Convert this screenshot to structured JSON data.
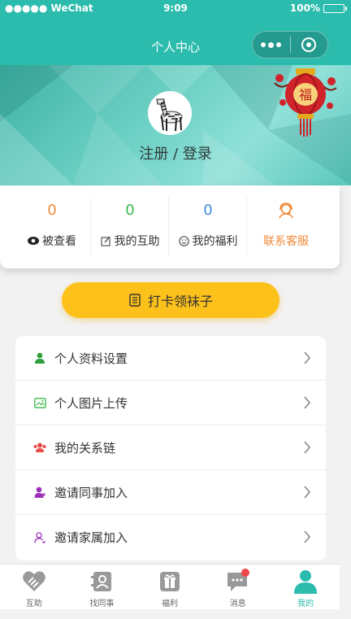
{
  "status_bar": {
    "carrier": "●●●●● WeChat",
    "time": "9:09",
    "battery": "100%"
  },
  "nav": {
    "title": "个人中心"
  },
  "profile": {
    "login_text": "注册 / 登录"
  },
  "stats": [
    {
      "value": "0",
      "label": "被查看",
      "icon": "eye-icon",
      "color": "#f08a3a"
    },
    {
      "value": "0",
      "label": "我的互助",
      "icon": "edit-icon",
      "color": "#3bb84a"
    },
    {
      "value": "0",
      "label": "我的福利",
      "icon": "smile-icon",
      "color": "#3a8fe0"
    },
    {
      "value": "",
      "label": "联系客服",
      "icon": "customer-service-icon",
      "color": "#f08a3a"
    }
  ],
  "checkin": {
    "label": "打卡领袜子",
    "icon": "list-icon"
  },
  "menu": [
    {
      "label": "个人资料设置",
      "icon": "user-icon",
      "color": "#2f9e3a"
    },
    {
      "label": "个人图片上传",
      "icon": "image-icon",
      "color": "#3bb84a"
    },
    {
      "label": "我的关系链",
      "icon": "group-icon",
      "color": "#e84a4a"
    },
    {
      "label": "邀请同事加入",
      "icon": "user-plus-icon",
      "color": "#9b2fb8"
    },
    {
      "label": "邀请家属加入",
      "icon": "user-outline-icon",
      "color": "#9b2fb8"
    }
  ],
  "tabs": [
    {
      "label": "互助",
      "icon": "handshake-icon",
      "active": false
    },
    {
      "label": "找同事",
      "icon": "contacts-icon",
      "active": false
    },
    {
      "label": "福利",
      "icon": "gift-icon",
      "active": false
    },
    {
      "label": "消息",
      "icon": "message-icon",
      "active": false,
      "badge": true
    },
    {
      "label": "我的",
      "icon": "person-icon",
      "active": true
    }
  ],
  "colors": {
    "primary": "#2bbcad",
    "accent": "#fcc11a",
    "tab_inactive": "#999999"
  }
}
